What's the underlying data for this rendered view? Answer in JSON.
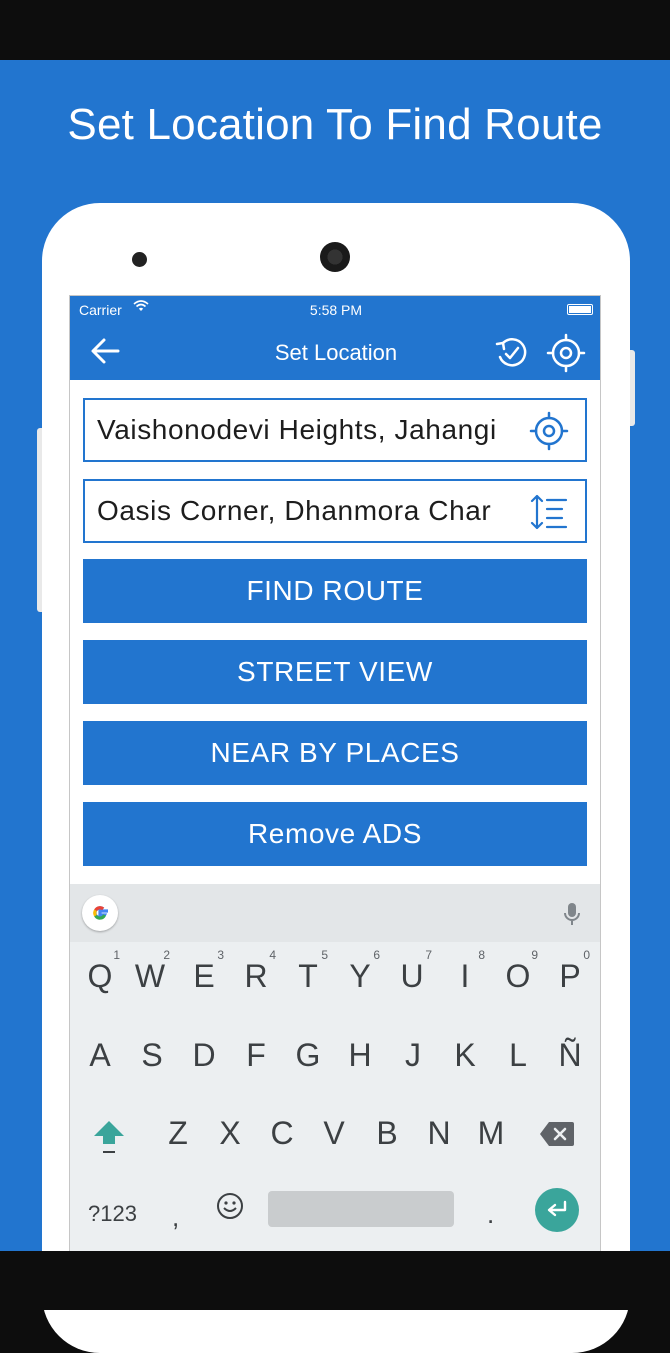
{
  "colors": {
    "brand_blue": "#2275cf",
    "enter_key": "#3aa59b"
  },
  "headline": "Set Location To Find Route",
  "status_bar": {
    "carrier": "Carrier",
    "time": "5:58 PM",
    "wifi_icon": "wifi-icon",
    "battery_icon": "battery-icon"
  },
  "toolbar": {
    "title": "Set Location",
    "back_icon": "arrow-left-icon",
    "history_icon": "history-icon",
    "locate_icon": "gps-target-icon"
  },
  "source_field": {
    "value": "Vaishonodevi Heights, Jahangi",
    "icon": "gps-target-icon"
  },
  "destination_field": {
    "value": "Oasis Corner, Dhanmora Char",
    "icon": "swap-list-icon"
  },
  "buttons": {
    "find_route": "FIND ROUTE",
    "street_view": "STREET VIEW",
    "near_by_places": "NEAR BY PLACES",
    "remove_ads": "Remove ADS"
  },
  "keyboard": {
    "row1": [
      {
        "key": "Q",
        "alt": "1"
      },
      {
        "key": "W",
        "alt": "2"
      },
      {
        "key": "E",
        "alt": "3"
      },
      {
        "key": "R",
        "alt": "4"
      },
      {
        "key": "T",
        "alt": "5"
      },
      {
        "key": "Y",
        "alt": "6"
      },
      {
        "key": "U",
        "alt": "7"
      },
      {
        "key": "I",
        "alt": "8"
      },
      {
        "key": "O",
        "alt": "9"
      },
      {
        "key": "P",
        "alt": "0"
      }
    ],
    "row2": [
      "A",
      "S",
      "D",
      "F",
      "G",
      "H",
      "J",
      "K",
      "L",
      "Ñ"
    ],
    "row3": [
      "Z",
      "X",
      "C",
      "V",
      "B",
      "N",
      "M"
    ],
    "symbols_key": "?123",
    "comma_key": ",",
    "period_key": "."
  }
}
